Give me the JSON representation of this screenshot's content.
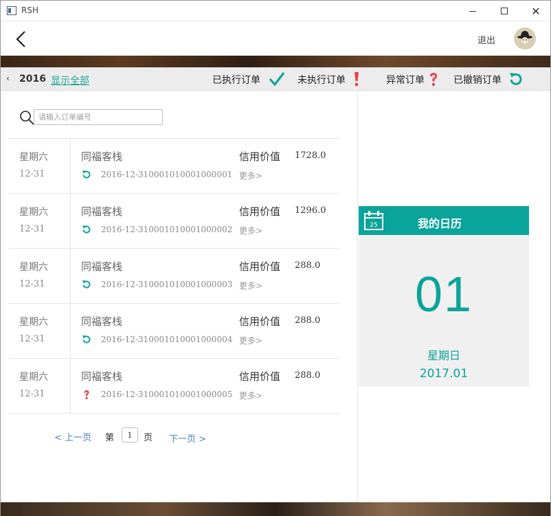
{
  "window": {
    "title": "RSH"
  },
  "header": {
    "logout_label": "退出"
  },
  "filter_bar": {
    "prev_label": "‹",
    "year": "2016",
    "show_all_label": "显示全部",
    "executed_label": "已执行订单",
    "unexecuted_label": "未执行订单",
    "abnormal_label": "异常订单",
    "cancelled_label": "已撤销订单"
  },
  "search": {
    "placeholder": "请输入订单编号"
  },
  "orders": [
    {
      "weekday": "星期六",
      "date": "12-31",
      "hotel": "同福客栈",
      "status_icon": "undo-icon",
      "order_no": "2016-12-310001010001000001",
      "credit_label": "信用价值",
      "credit_value": "1728.0",
      "more_label": "更多>"
    },
    {
      "weekday": "星期六",
      "date": "12-31",
      "hotel": "同福客栈",
      "status_icon": "undo-icon",
      "order_no": "2016-12-310001010001000002",
      "credit_label": "信用价值",
      "credit_value": "1296.0",
      "more_label": "更多>"
    },
    {
      "weekday": "星期六",
      "date": "12-31",
      "hotel": "同福客栈",
      "status_icon": "undo-icon",
      "order_no": "2016-12-310001010001000003",
      "credit_label": "信用价值",
      "credit_value": "288.0",
      "more_label": "更多>"
    },
    {
      "weekday": "星期六",
      "date": "12-31",
      "hotel": "同福客栈",
      "status_icon": "undo-icon",
      "order_no": "2016-12-310001010001000004",
      "credit_label": "信用价值",
      "credit_value": "288.0",
      "more_label": "更多>"
    },
    {
      "weekday": "星期六",
      "date": "12-31",
      "hotel": "同福客栈",
      "status_icon": "question-icon",
      "order_no": "2016-12-310001010001000005",
      "credit_label": "信用价值",
      "credit_value": "288.0",
      "more_label": "更多>"
    }
  ],
  "pager": {
    "prev_label": "< 上一页",
    "page_prefix": "第",
    "page_value": "1",
    "page_suffix": "页",
    "next_label": "下一页 >"
  },
  "calendar": {
    "title": "我的日历",
    "icon_day": "25",
    "day": "01",
    "weekday": "星期日",
    "year_month": "2017.01"
  },
  "colors": {
    "accent": "#0aa49a",
    "alert_red": "#e8404a",
    "link_blue": "#4a7dbd"
  }
}
